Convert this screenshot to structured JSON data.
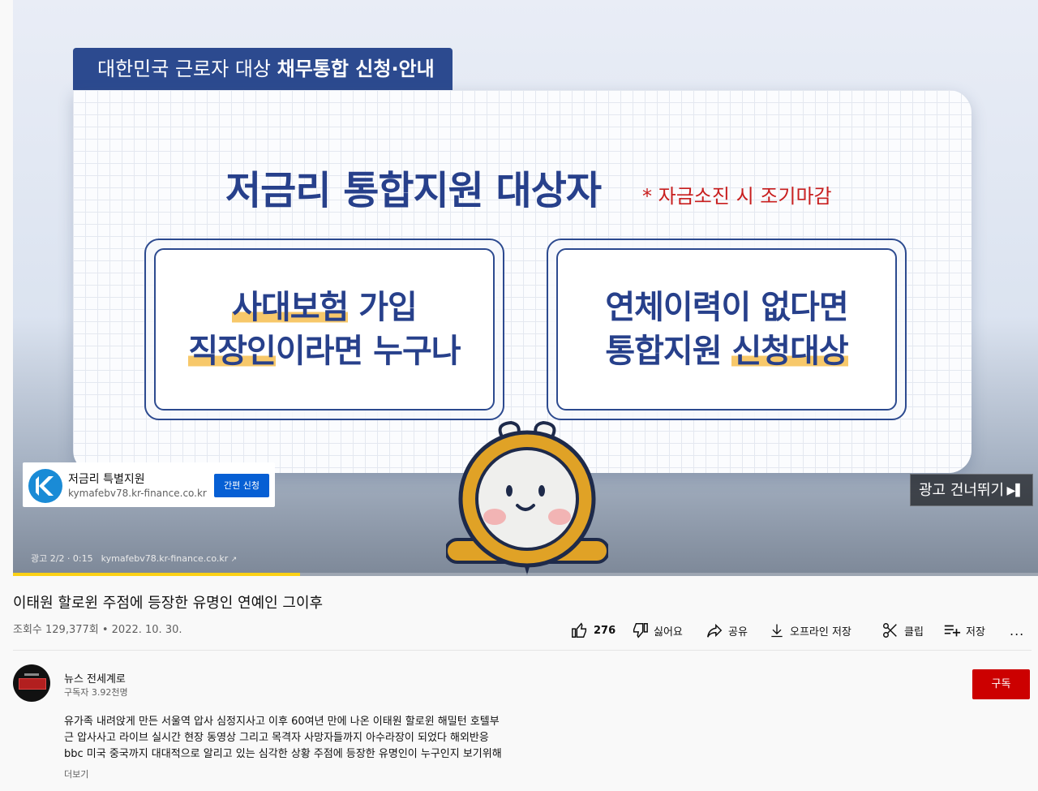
{
  "ad": {
    "header_prefix": "대한민국 근로자 대상 ",
    "header_bold": "채무통합 신청·안내",
    "title": "저금리 통합지원 대상자",
    "note": "* 자금소진 시 조기마감",
    "left_box": {
      "line1_hl": "사대보험",
      "line1_rest": " 가입",
      "line2_hl": "직장인",
      "line2_rest": "이라면 누구나"
    },
    "right_box": {
      "line1": "연체이력이 없다면",
      "line2_rest": "통합지원 ",
      "line2_hl": "신청대상"
    },
    "sponsor": {
      "name": "저금리 특별지원",
      "url": "kymafebv78.kr-finance.co.kr",
      "button": "간편 신청"
    },
    "skip_label": "광고 건너뛰기",
    "skip_icon": "skip-next-icon",
    "info_counter": "광고 2/2 · 0:15",
    "info_url": "kymafebv78.kr-finance.co.kr",
    "progress_fraction": 0.28,
    "colors": {
      "navy": "#2c4a8f",
      "highlight": "#f7c86a",
      "note_red": "#c81e1e",
      "progress": "#fcd116"
    }
  },
  "video": {
    "title": "이태원 할로윈 주점에 등장한 유명인 연예인 그이후",
    "views": "조회수 129,377회 • 2022. 10. 30."
  },
  "actions": {
    "like_count": "276",
    "dislike": "싫어요",
    "share": "공유",
    "offline_save": "오프라인 저장",
    "clip": "클립",
    "save": "저장",
    "more": "..."
  },
  "channel": {
    "name": "뉴스 전세계로",
    "subscribers": "구독자 3.92천명",
    "subscribe_label": "구독"
  },
  "description": {
    "lines": [
      "유가족 내려앉게 만든 서울역 압사 심정지사고 이후 60여년 만에 나온 이태원 할로윈 해밀턴 호텔부",
      "근 압사사고 라이브 실시간 현장 동영상 그리고 목격자 사망자들까지 아수라장이 되었다 해외반응",
      "bbc 미국 중국까지 대대적으로 알리고 있는 심각한 상황 주점에 등장한 유명인이 누구인지 보기위해"
    ],
    "more_label": "더보기"
  }
}
